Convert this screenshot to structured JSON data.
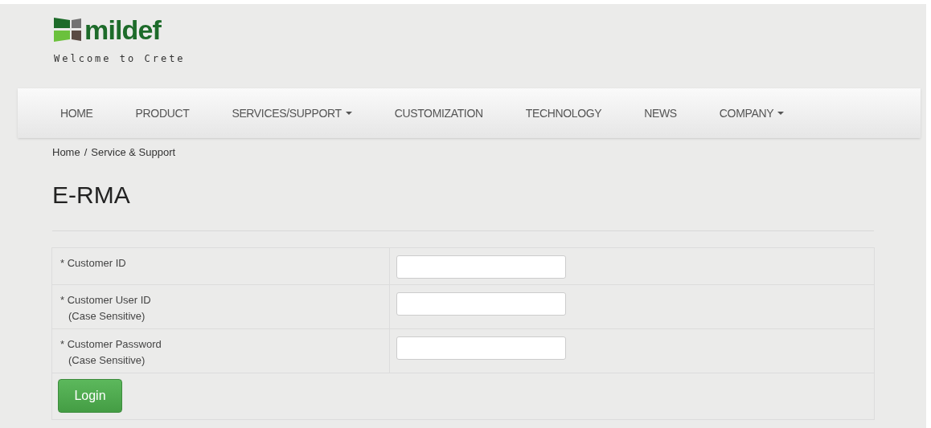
{
  "logo": {
    "name": "mildef",
    "tagline": "Welcome to Crete"
  },
  "nav": [
    {
      "label": "HOME",
      "dropdown": false
    },
    {
      "label": "PRODUCT",
      "dropdown": false
    },
    {
      "label": "SERVICES/SUPPORT",
      "dropdown": true
    },
    {
      "label": "CUSTOMIZATION",
      "dropdown": false
    },
    {
      "label": "TECHNOLOGY",
      "dropdown": false
    },
    {
      "label": "NEWS",
      "dropdown": false
    },
    {
      "label": "COMPANY",
      "dropdown": true
    }
  ],
  "breadcrumb": [
    "Home",
    "/",
    "Service & Support"
  ],
  "title": "E-RMA",
  "form": {
    "fields": [
      {
        "label": "* Customer ID"
      },
      {
        "label": "* Customer User ID",
        "note": "(Case Sensitive)"
      },
      {
        "label": "* Customer Password",
        "note": "(Case Sensitive)"
      }
    ],
    "button": "Login"
  }
}
